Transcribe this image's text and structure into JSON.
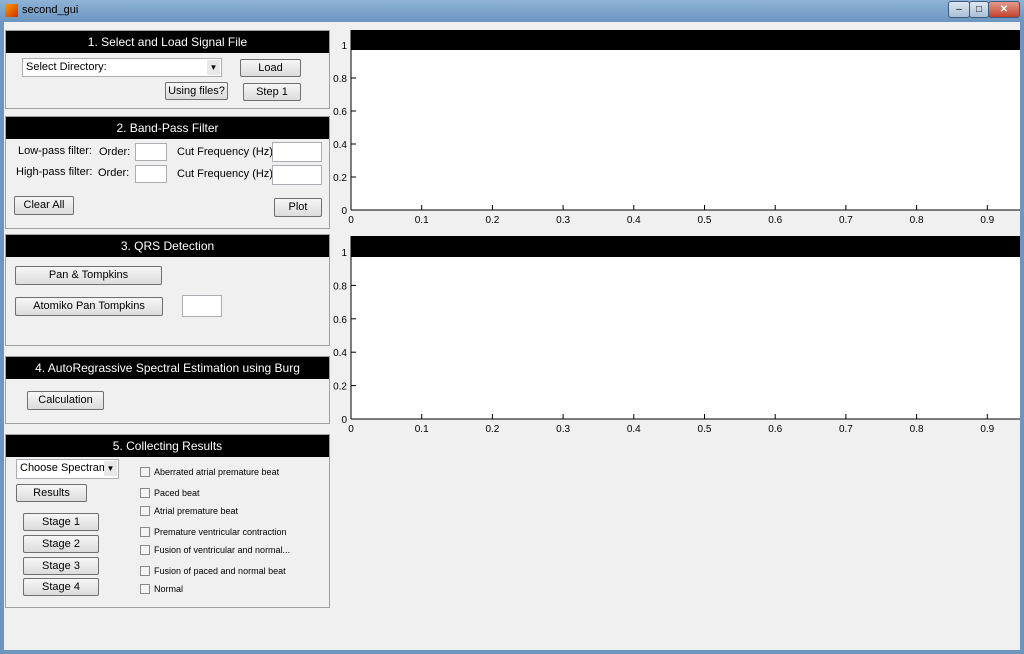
{
  "window": {
    "title": "second_gui",
    "minimize": "–",
    "maximize": "□",
    "close": "✕"
  },
  "panel1": {
    "title": "1. Select and Load Signal File",
    "directory_select": "Select Directory:",
    "load": "Load",
    "using_files": "Using files?",
    "step1": "Step 1"
  },
  "panel2": {
    "title": "2. Band-Pass Filter",
    "lowpass_label": "Low-pass filter:",
    "highpass_label": "High-pass filter:",
    "order_label": "Order:",
    "cutfreq_label": "Cut Frequency (Hz):",
    "lowpass_order": "",
    "lowpass_cut": "",
    "highpass_order": "",
    "highpass_cut": "",
    "clear_all": "Clear All",
    "plot": "Plot"
  },
  "panel3": {
    "title": "3. QRS Detection",
    "pan_tompkins": "Pan & Tompkins",
    "atomiko": "Atomiko Pan Tompkins",
    "value": ""
  },
  "panel4": {
    "title": "4. AutoRegrassive Spectral Estimation using Burg",
    "calculation": "Calculation"
  },
  "panel5": {
    "title": "5. Collecting Results",
    "spectrum_select": "Choose Spectram:",
    "results": "Results",
    "stages": [
      "Stage 1",
      "Stage 2",
      "Stage 3",
      "Stage 4"
    ],
    "checkboxes": [
      "Aberrated atrial premature beat",
      "Paced beat",
      "Atrial premature beat",
      "Premature ventricular contraction",
      "Fusion of ventricular and normal...",
      "Fusion of paced and normal beat",
      "Normal"
    ]
  },
  "chart_data": [
    {
      "type": "line",
      "series": [],
      "xlim": [
        0,
        1
      ],
      "ylim": [
        0,
        1
      ],
      "xticks": [
        "0",
        "0.1",
        "0.2",
        "0.3",
        "0.4",
        "0.5",
        "0.6",
        "0.7",
        "0.8",
        "0.9"
      ],
      "yticks": [
        "0",
        "0.2",
        "0.4",
        "0.6",
        "0.8",
        "1"
      ],
      "grid": false
    },
    {
      "type": "line",
      "series": [],
      "xlim": [
        0,
        1
      ],
      "ylim": [
        0,
        1
      ],
      "xticks": [
        "0",
        "0.1",
        "0.2",
        "0.3",
        "0.4",
        "0.5",
        "0.6",
        "0.7",
        "0.8",
        "0.9"
      ],
      "yticks": [
        "0",
        "0.2",
        "0.4",
        "0.6",
        "0.8",
        "1"
      ],
      "grid": false
    }
  ]
}
